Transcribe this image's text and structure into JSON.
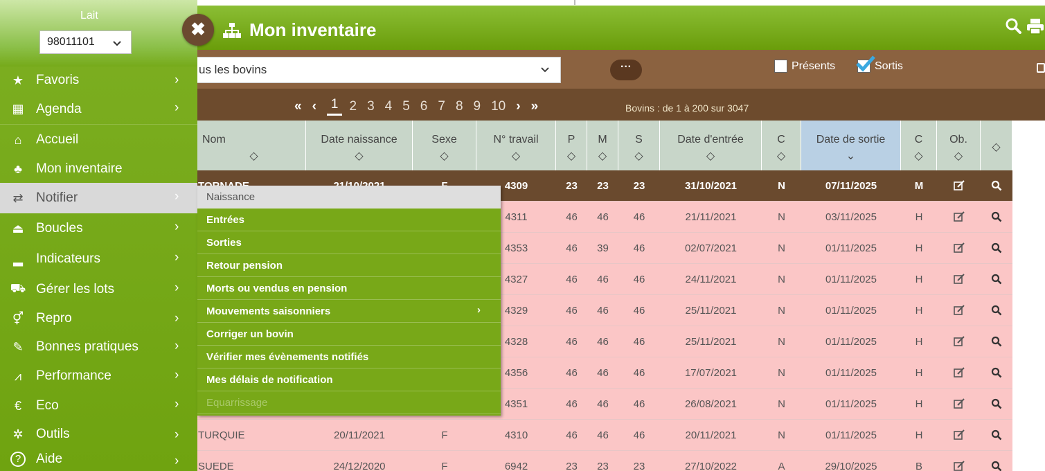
{
  "header": {
    "title": "Mon inventaire",
    "close_label": "✖"
  },
  "sidebar": {
    "herd_label": "Lait",
    "herd_value": "98011101",
    "items": [
      {
        "label": "Favoris",
        "icon": "star-icon"
      },
      {
        "label": "Agenda",
        "icon": "calendar-icon"
      },
      {
        "label": "Accueil",
        "icon": "home-icon"
      },
      {
        "label": "Mon inventaire",
        "icon": "sitemap-icon"
      },
      {
        "label": "Notifier",
        "icon": "exchange-icon"
      },
      {
        "label": "Boucles",
        "icon": "tag-icon"
      },
      {
        "label": "Indicateurs",
        "icon": "bar-chart-icon"
      },
      {
        "label": "Gérer les lots",
        "icon": "cow-icon"
      },
      {
        "label": "Repro",
        "icon": "venus-mars-icon"
      },
      {
        "label": "Bonnes pratiques",
        "icon": "syringe-icon"
      },
      {
        "label": "Performance",
        "icon": "line-chart-icon"
      },
      {
        "label": "Eco",
        "icon": "euro-icon"
      },
      {
        "label": "Outils",
        "icon": "gear-icon"
      },
      {
        "label": "Aide",
        "icon": "help-icon"
      }
    ]
  },
  "submenu": {
    "items": [
      {
        "label": "Naissance"
      },
      {
        "label": "Entrées"
      },
      {
        "label": "Sorties"
      },
      {
        "label": "Retour pension"
      },
      {
        "label": "Morts ou vendus en pension"
      },
      {
        "label": "Mouvements saisonniers"
      },
      {
        "label": "Corriger un bovin"
      },
      {
        "label": "Vérifier mes évènements notifiés"
      },
      {
        "label": "Mes délais de notification"
      },
      {
        "label": "Equarrissage"
      }
    ]
  },
  "filters": {
    "herd_select": "us les bovins",
    "more_label": "···",
    "presents_label": "Présents",
    "presents_checked": false,
    "sortis_label": "Sortis",
    "sortis_checked": true
  },
  "pagination": {
    "first": "«",
    "prev": "‹",
    "pages": [
      "1",
      "2",
      "3",
      "4",
      "5",
      "6",
      "7",
      "8",
      "9",
      "10"
    ],
    "current": "1",
    "next": "›",
    "last": "»",
    "info": "Bovins : de 1 à 200 sur 3047"
  },
  "table": {
    "columns": [
      "Nom",
      "Date naissance",
      "Sexe",
      "N° travail",
      "P",
      "M",
      "S",
      "Date d'entrée",
      "C",
      "Date de sortie",
      "C",
      "Ob.",
      ""
    ],
    "sort_icon": "◇",
    "sorted_icon": "⌄",
    "rows": [
      [
        "TORNADE",
        "21/10/2021",
        "F",
        "4309",
        "23",
        "23",
        "23",
        "31/10/2021",
        "N",
        "07/11/2025",
        "M"
      ],
      [
        "",
        "",
        "",
        "4311",
        "46",
        "46",
        "46",
        "21/11/2021",
        "N",
        "03/11/2025",
        "H"
      ],
      [
        "",
        "",
        "",
        "4353",
        "46",
        "39",
        "46",
        "02/07/2021",
        "N",
        "01/11/2025",
        "H"
      ],
      [
        "",
        "",
        "",
        "4327",
        "46",
        "46",
        "46",
        "24/11/2021",
        "N",
        "01/11/2025",
        "H"
      ],
      [
        "",
        "",
        "",
        "4329",
        "46",
        "46",
        "46",
        "25/11/2021",
        "N",
        "01/11/2025",
        "H"
      ],
      [
        "",
        "",
        "",
        "4328",
        "46",
        "46",
        "46",
        "25/11/2021",
        "N",
        "01/11/2025",
        "H"
      ],
      [
        "",
        "",
        "",
        "4356",
        "46",
        "46",
        "46",
        "17/07/2021",
        "N",
        "01/11/2025",
        "H"
      ],
      [
        "",
        "",
        "",
        "4351",
        "46",
        "46",
        "46",
        "26/08/2021",
        "N",
        "01/11/2025",
        "H"
      ],
      [
        "TURQUIE",
        "20/11/2021",
        "F",
        "4310",
        "46",
        "46",
        "46",
        "20/11/2021",
        "N",
        "01/11/2025",
        "H"
      ],
      [
        "SUEDE",
        "24/12/2020",
        "F",
        "6942",
        "23",
        "23",
        "23",
        "27/10/2022",
        "A",
        "29/10/2025",
        "B"
      ]
    ]
  }
}
